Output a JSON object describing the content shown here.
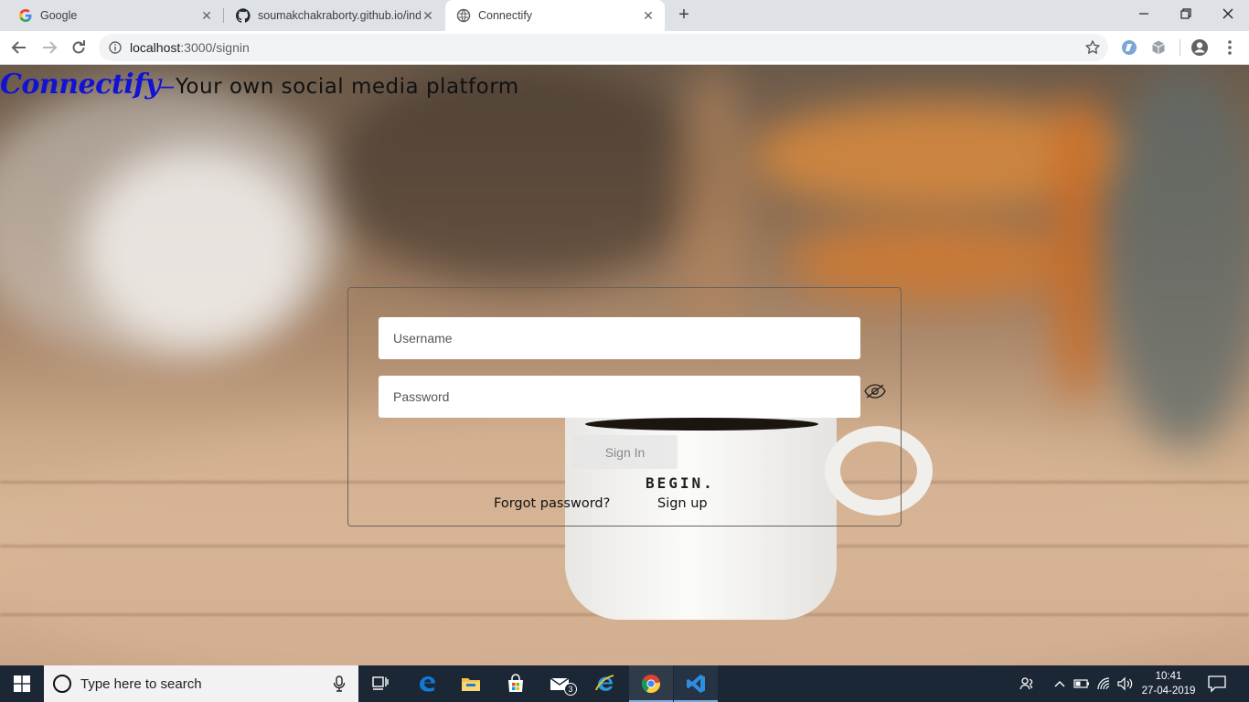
{
  "browser": {
    "tabs": [
      {
        "title": "Google",
        "favicon": "google-g-icon"
      },
      {
        "title": "soumakchakraborty.github.io/ind",
        "favicon": "github-icon"
      },
      {
        "title": "Connectify",
        "favicon": "globe-icon",
        "active": true
      }
    ],
    "url_host": "localhost",
    "url_path": ":3000/signin"
  },
  "page": {
    "brand_logo": "Connectify",
    "brand_dash": "–",
    "tagline": "Your own social media platform",
    "username_placeholder": "Username",
    "password_placeholder": "Password",
    "signin_label": "Sign In",
    "forgot_label": "Forgot password?",
    "signup_label": "Sign up",
    "mug_text": "BEGIN."
  },
  "taskbar": {
    "search_placeholder": "Type here to search",
    "mail_badge": "3",
    "time": "10:41",
    "date": "27-04-2019"
  },
  "colors": {
    "brand": "#1212d4",
    "taskbar": "#1b2734",
    "tabstrip": "#dee1e6"
  }
}
